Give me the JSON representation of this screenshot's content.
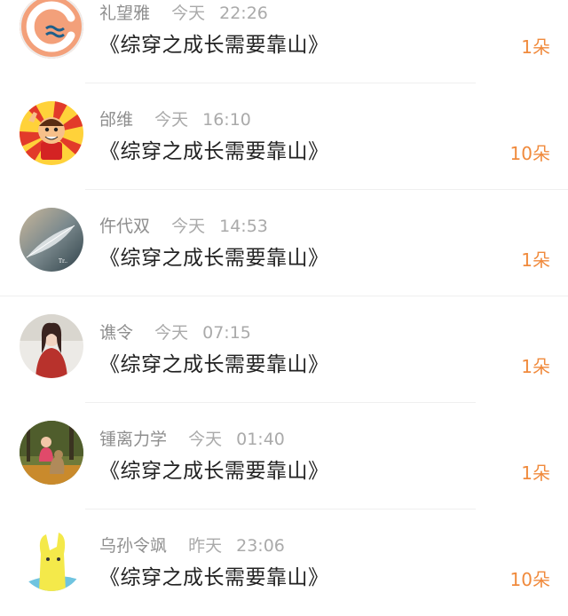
{
  "items": [
    {
      "name": "礼望雅",
      "day": "今天",
      "time": "22:26",
      "title": "《综穿之成长需要靠山》",
      "count": "1朵",
      "avatar_icon": "orange-logo-avatar-icon"
    },
    {
      "name": "邰维",
      "day": "今天",
      "time": "16:10",
      "title": "《综穿之成长需要靠山》",
      "count": "10朵",
      "avatar_icon": "cartoon-basketball-player-avatar-icon"
    },
    {
      "name": "仵代双",
      "day": "今天",
      "time": "14:53",
      "title": "《综穿之成长需要靠山》",
      "count": "1朵",
      "avatar_icon": "frosted-leaf-avatar-icon"
    },
    {
      "name": "谯令",
      "day": "今天",
      "time": "07:15",
      "title": "《综穿之成长需要靠山》",
      "count": "1朵",
      "avatar_icon": "woman-red-coat-avatar-icon"
    },
    {
      "name": "锺离力学",
      "day": "今天",
      "time": "01:40",
      "title": "《综穿之成长需要靠山》",
      "count": "1朵",
      "avatar_icon": "child-autumn-park-avatar-icon"
    },
    {
      "name": "乌孙令飒",
      "day": "昨天",
      "time": "23:06",
      "title": "《综穿之成长需要靠山》",
      "count": "10朵",
      "avatar_icon": "yellow-cartoon-creature-avatar-icon"
    }
  ],
  "colors": {
    "count": "#f08a3c",
    "name": "#8e8e8e",
    "title": "#222222",
    "divider": "#efefef"
  }
}
